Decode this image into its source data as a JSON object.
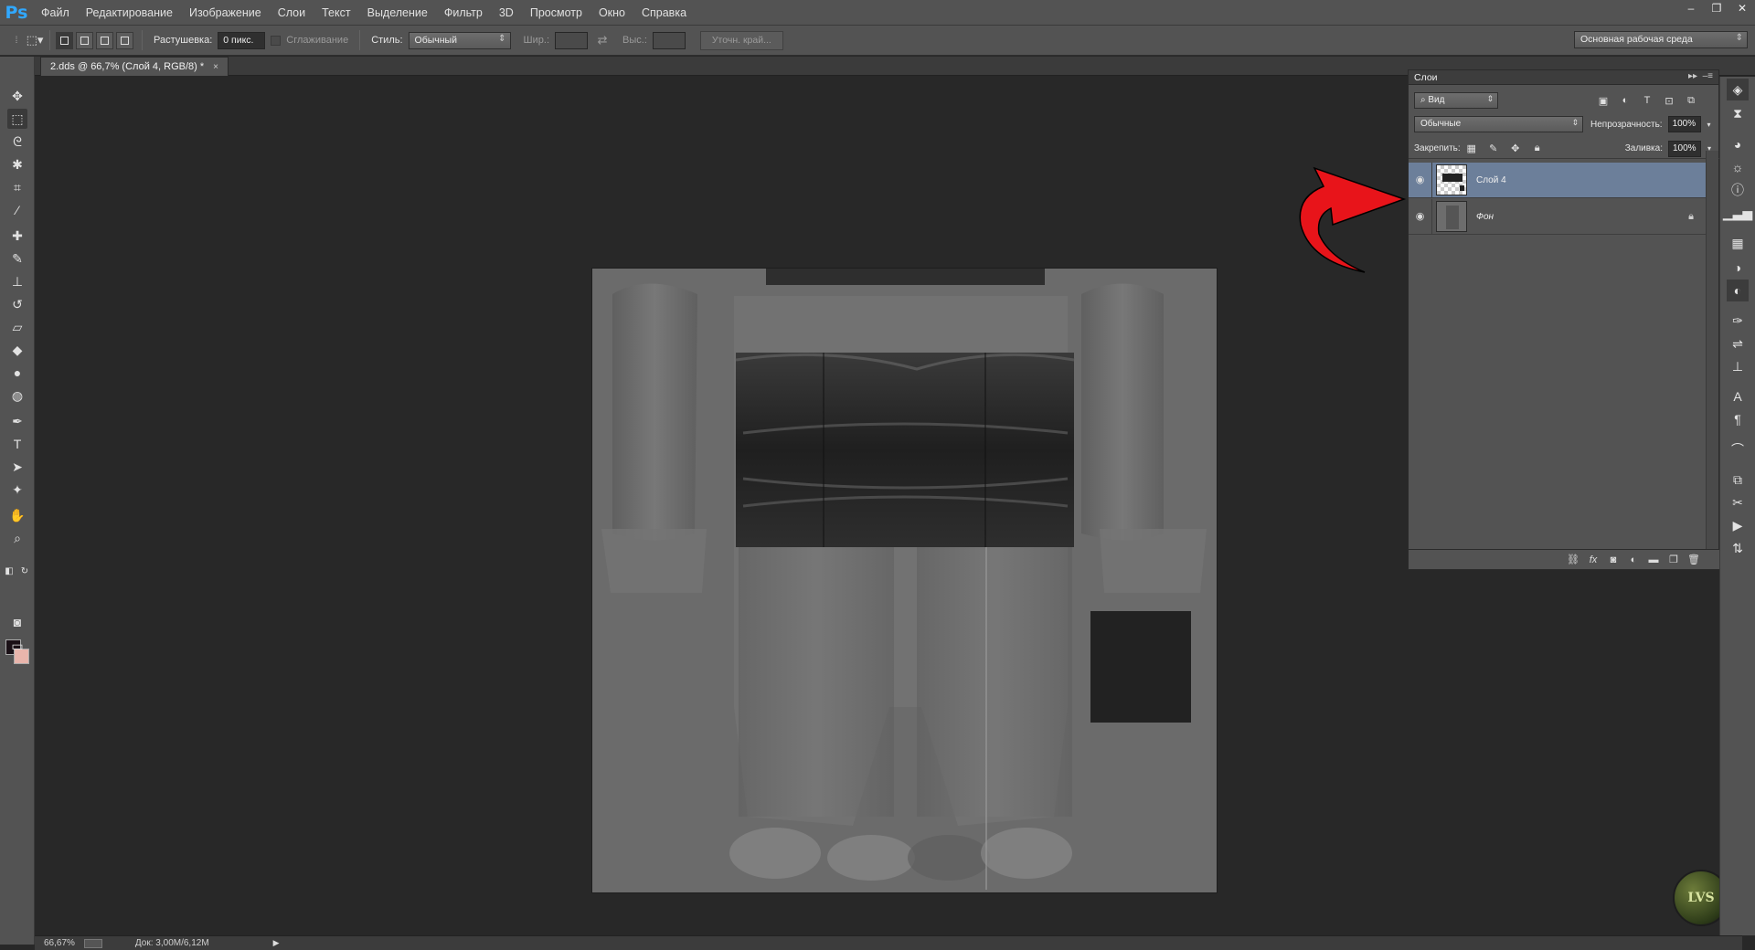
{
  "app": {
    "logo": "Ps",
    "menu": [
      "Файл",
      "Редактирование",
      "Изображение",
      "Слои",
      "Текст",
      "Выделение",
      "Фильтр",
      "3D",
      "Просмотр",
      "Окно",
      "Справка"
    ],
    "window_controls": [
      "–",
      "❐",
      "✕"
    ]
  },
  "options": {
    "feather_label": "Растушевка:",
    "feather_value": "0 пикс.",
    "antialias_label": "Сглаживание",
    "style_label": "Стиль:",
    "style_value": "Обычный",
    "width_label": "Шир.:",
    "height_label": "Выс.:",
    "refine_edge": "Уточн. край...",
    "workspace": "Основная рабочая среда"
  },
  "document": {
    "tab_title": "2.dds @ 66,7% (Слой 4, RGB/8) *",
    "tab_close": "×"
  },
  "layers_panel": {
    "title": "Слои",
    "filter_kind": "Вид",
    "blend_mode": "Обычные",
    "opacity_label": "Непрозрачность:",
    "opacity_value": "100%",
    "lock_label": "Закрепить:",
    "fill_label": "Заливка:",
    "fill_value": "100%",
    "layers": [
      {
        "name": "Слой 4",
        "selected": true,
        "visible": true
      },
      {
        "name": "Фон",
        "selected": false,
        "visible": true,
        "locked": true
      }
    ],
    "footer_icons": [
      "link-icon",
      "fx-icon",
      "mask-icon",
      "adjustment-icon",
      "folder-icon",
      "new-layer-icon",
      "trash-icon"
    ]
  },
  "status": {
    "zoom": "66,67%",
    "doc_size": "Док: 3,00M/6,12M"
  },
  "colors": {
    "foreground": "#1a1016",
    "background": "#e9b5ac",
    "selected_layer": "#6c7f9a",
    "annotation_arrow": "#e8141a",
    "ps_blue": "#31a8ff"
  },
  "watermark": "LVS"
}
